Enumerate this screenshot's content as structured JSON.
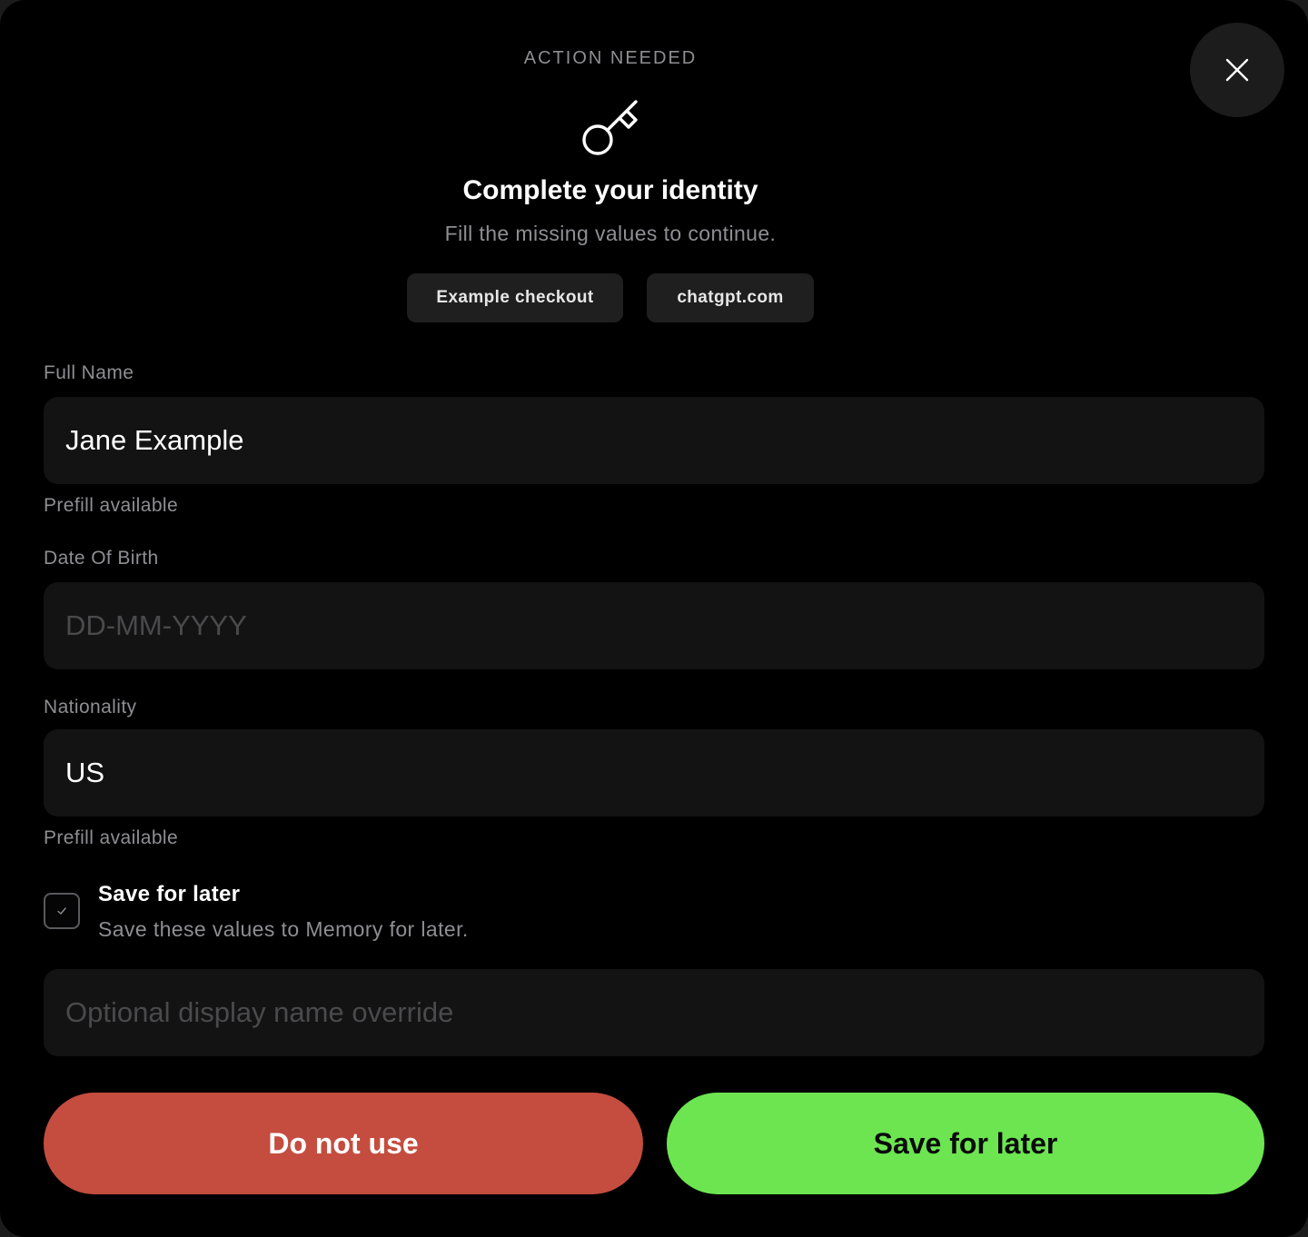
{
  "header": {
    "eyebrow": "ACTION NEEDED",
    "icon": "key-icon",
    "title": "Complete your identity",
    "subtitle": "Fill the missing values to continue."
  },
  "chips": [
    {
      "label": "Example checkout"
    },
    {
      "label": "chatgpt.com"
    }
  ],
  "close": {
    "icon": "close-icon"
  },
  "fields": {
    "full_name": {
      "label": "Full Name",
      "value": "Jane Example",
      "helper": "Prefill available"
    },
    "dob": {
      "label": "Date Of Birth",
      "value": "",
      "placeholder": "DD-MM-YYYY"
    },
    "nationality": {
      "label": "Nationality",
      "value": "US",
      "helper": "Prefill available"
    }
  },
  "save_option": {
    "checked": true,
    "title": "Save for later",
    "description": "Save these values to Memory for later."
  },
  "override": {
    "value": "",
    "placeholder": "Optional display name override"
  },
  "actions": {
    "decline_label": "Do not use",
    "save_label": "Save for later"
  },
  "colors": {
    "background": "#000000",
    "decline": "#c44d3f",
    "save": "#6ce551",
    "muted_text": "#8e8e93",
    "input_bg": "#131313"
  }
}
